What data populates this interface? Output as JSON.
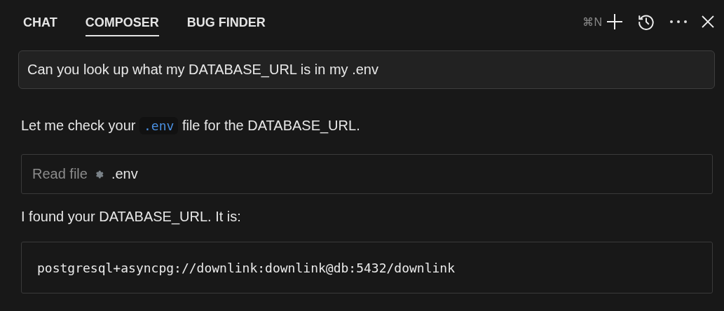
{
  "tabs": [
    {
      "label": "CHAT",
      "selected": false
    },
    {
      "label": "COMPOSER",
      "selected": true
    },
    {
      "label": "BUG FINDER",
      "selected": false
    }
  ],
  "toolbar": {
    "shortcut": "⌘N"
  },
  "prompt": {
    "value": "Can you look up what my DATABASE_URL is in my .env"
  },
  "messages": [
    {
      "kind": "text",
      "parts": [
        {
          "kind": "text",
          "text": "Let me check your "
        },
        {
          "kind": "code",
          "text": ".env"
        },
        {
          "kind": "text",
          "text": " file for the DATABASE_URL."
        }
      ]
    },
    {
      "kind": "tool",
      "action": "Read file",
      "target": ".env"
    },
    {
      "kind": "text",
      "parts": [
        {
          "kind": "text",
          "text": "I found your DATABASE_URL. It is:"
        }
      ]
    },
    {
      "kind": "codeblock",
      "code": "postgresql+asyncpg://downlink:downlink@db:5432/downlink"
    }
  ]
}
